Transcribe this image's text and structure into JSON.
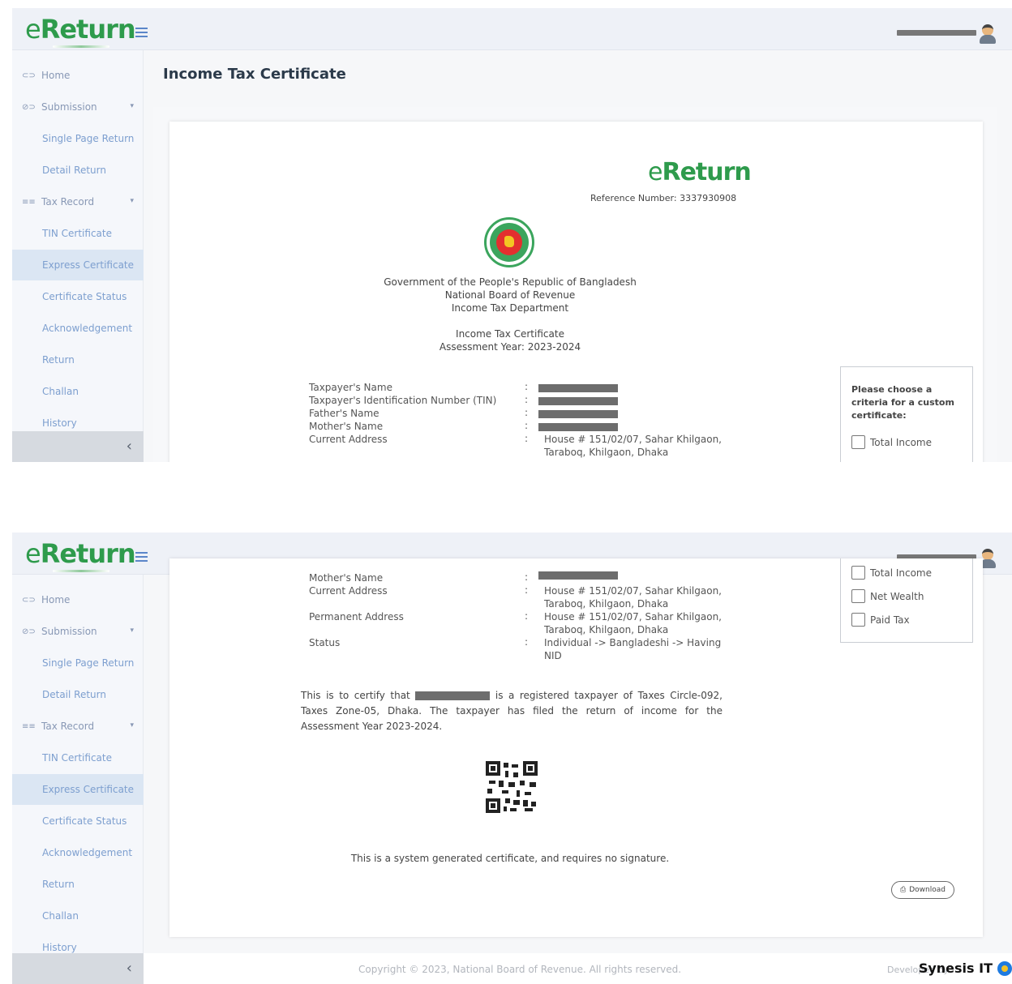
{
  "app": {
    "logo_e": "e",
    "logo_return": "Return",
    "page_title": "Income Tax Certificate"
  },
  "sidebar": {
    "items": [
      {
        "label": "Home",
        "icon": "home-icon"
      },
      {
        "label": "Submission",
        "icon": "submission-icon"
      },
      {
        "label": "Single Page Return"
      },
      {
        "label": "Detail Return"
      },
      {
        "label": "Tax Record",
        "icon": "tax-record-icon"
      },
      {
        "label": "TIN Certificate"
      },
      {
        "label": "Express Certificate",
        "active": true
      },
      {
        "label": "Certificate Status"
      },
      {
        "label": "Acknowledgement"
      },
      {
        "label": "Return"
      },
      {
        "label": "Challan"
      },
      {
        "label": "History"
      }
    ],
    "collapse_glyph": "‹"
  },
  "certificate": {
    "logo_e": "e",
    "logo_return": "Return",
    "reference": "Reference Number: 3337930908",
    "gov_line1": "Government of the People's Republic of Bangladesh",
    "gov_line2": "National Board of Revenue",
    "gov_line3": "Income Tax Department",
    "title": "Income Tax Certificate",
    "assessment_year": "Assessment Year: 2023-2024",
    "fields": {
      "taxpayer_name": "Taxpayer's Name",
      "tin": "Taxpayer's Identification Number (TIN)",
      "father": "Father's Name",
      "mother": "Mother's Name",
      "current_address": "Current Address",
      "permanent_address": "Permanent Address",
      "status": "Status"
    },
    "colon": ":",
    "current_address_value": "House # 151/02/07, Sahar Khilgaon, Taraboq, Khilgaon, Dhaka",
    "permanent_address_value": "House # 151/02/07, Sahar Khilgaon, Taraboq, Khilgaon, Dhaka",
    "status_value": "Individual -> Bangladeshi -> Having NID",
    "certify_prefix": "This is to certify that",
    "certify_suffix": "is a registered taxpayer of Taxes Circle-092, Taxes Zone-05, Dhaka. The taxpayer has filed the return of income for the Assessment Year 2023-2024.",
    "system_note": "This is a system generated certificate, and requires no signature.",
    "download_label": "Download"
  },
  "criteria": {
    "title": "Please choose a criteria for a custom certificate:",
    "options": [
      "Total Income",
      "Net Wealth",
      "Paid Tax"
    ]
  },
  "footer": {
    "copyright": "Copyright © 2023, National Board of Revenue. All rights reserved.",
    "developed_by": "Developed by",
    "brand": "Synesis IT"
  },
  "colors": {
    "brand_green": "#2e9b4c",
    "sidebar_active": "#dbe6f3",
    "link_blue": "#7d9fcf"
  }
}
